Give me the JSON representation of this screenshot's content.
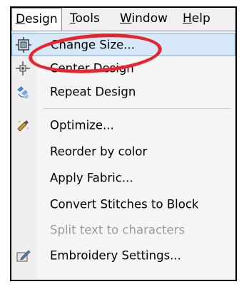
{
  "menubar": {
    "items": [
      {
        "label": "Design",
        "accel": "D",
        "rest": "esign",
        "active": true
      },
      {
        "label": "Tools",
        "accel": "T",
        "rest": "ools"
      },
      {
        "label": "Window",
        "accel": "W",
        "rest": "indow"
      },
      {
        "label": "Help",
        "accel": "H",
        "rest": "elp"
      }
    ]
  },
  "menu": {
    "items": [
      {
        "label": "Change Size...",
        "icon": "resize-icon",
        "highlighted": true
      },
      {
        "label": "Center Design",
        "icon": "center-icon"
      },
      {
        "label": "Repeat Design",
        "icon": "repeat-icon"
      },
      {
        "label": "Optimize...",
        "icon": "optimize-icon"
      },
      {
        "label": "Reorder by color"
      },
      {
        "label": "Apply Fabric..."
      },
      {
        "label": "Convert Stitches to Block"
      },
      {
        "label": "Split text to characters",
        "disabled": true
      },
      {
        "label": "Embroidery Settings...",
        "icon": "settings-icon"
      }
    ]
  },
  "annotation": {
    "color": "#e8242d",
    "shape": "ellipse"
  }
}
